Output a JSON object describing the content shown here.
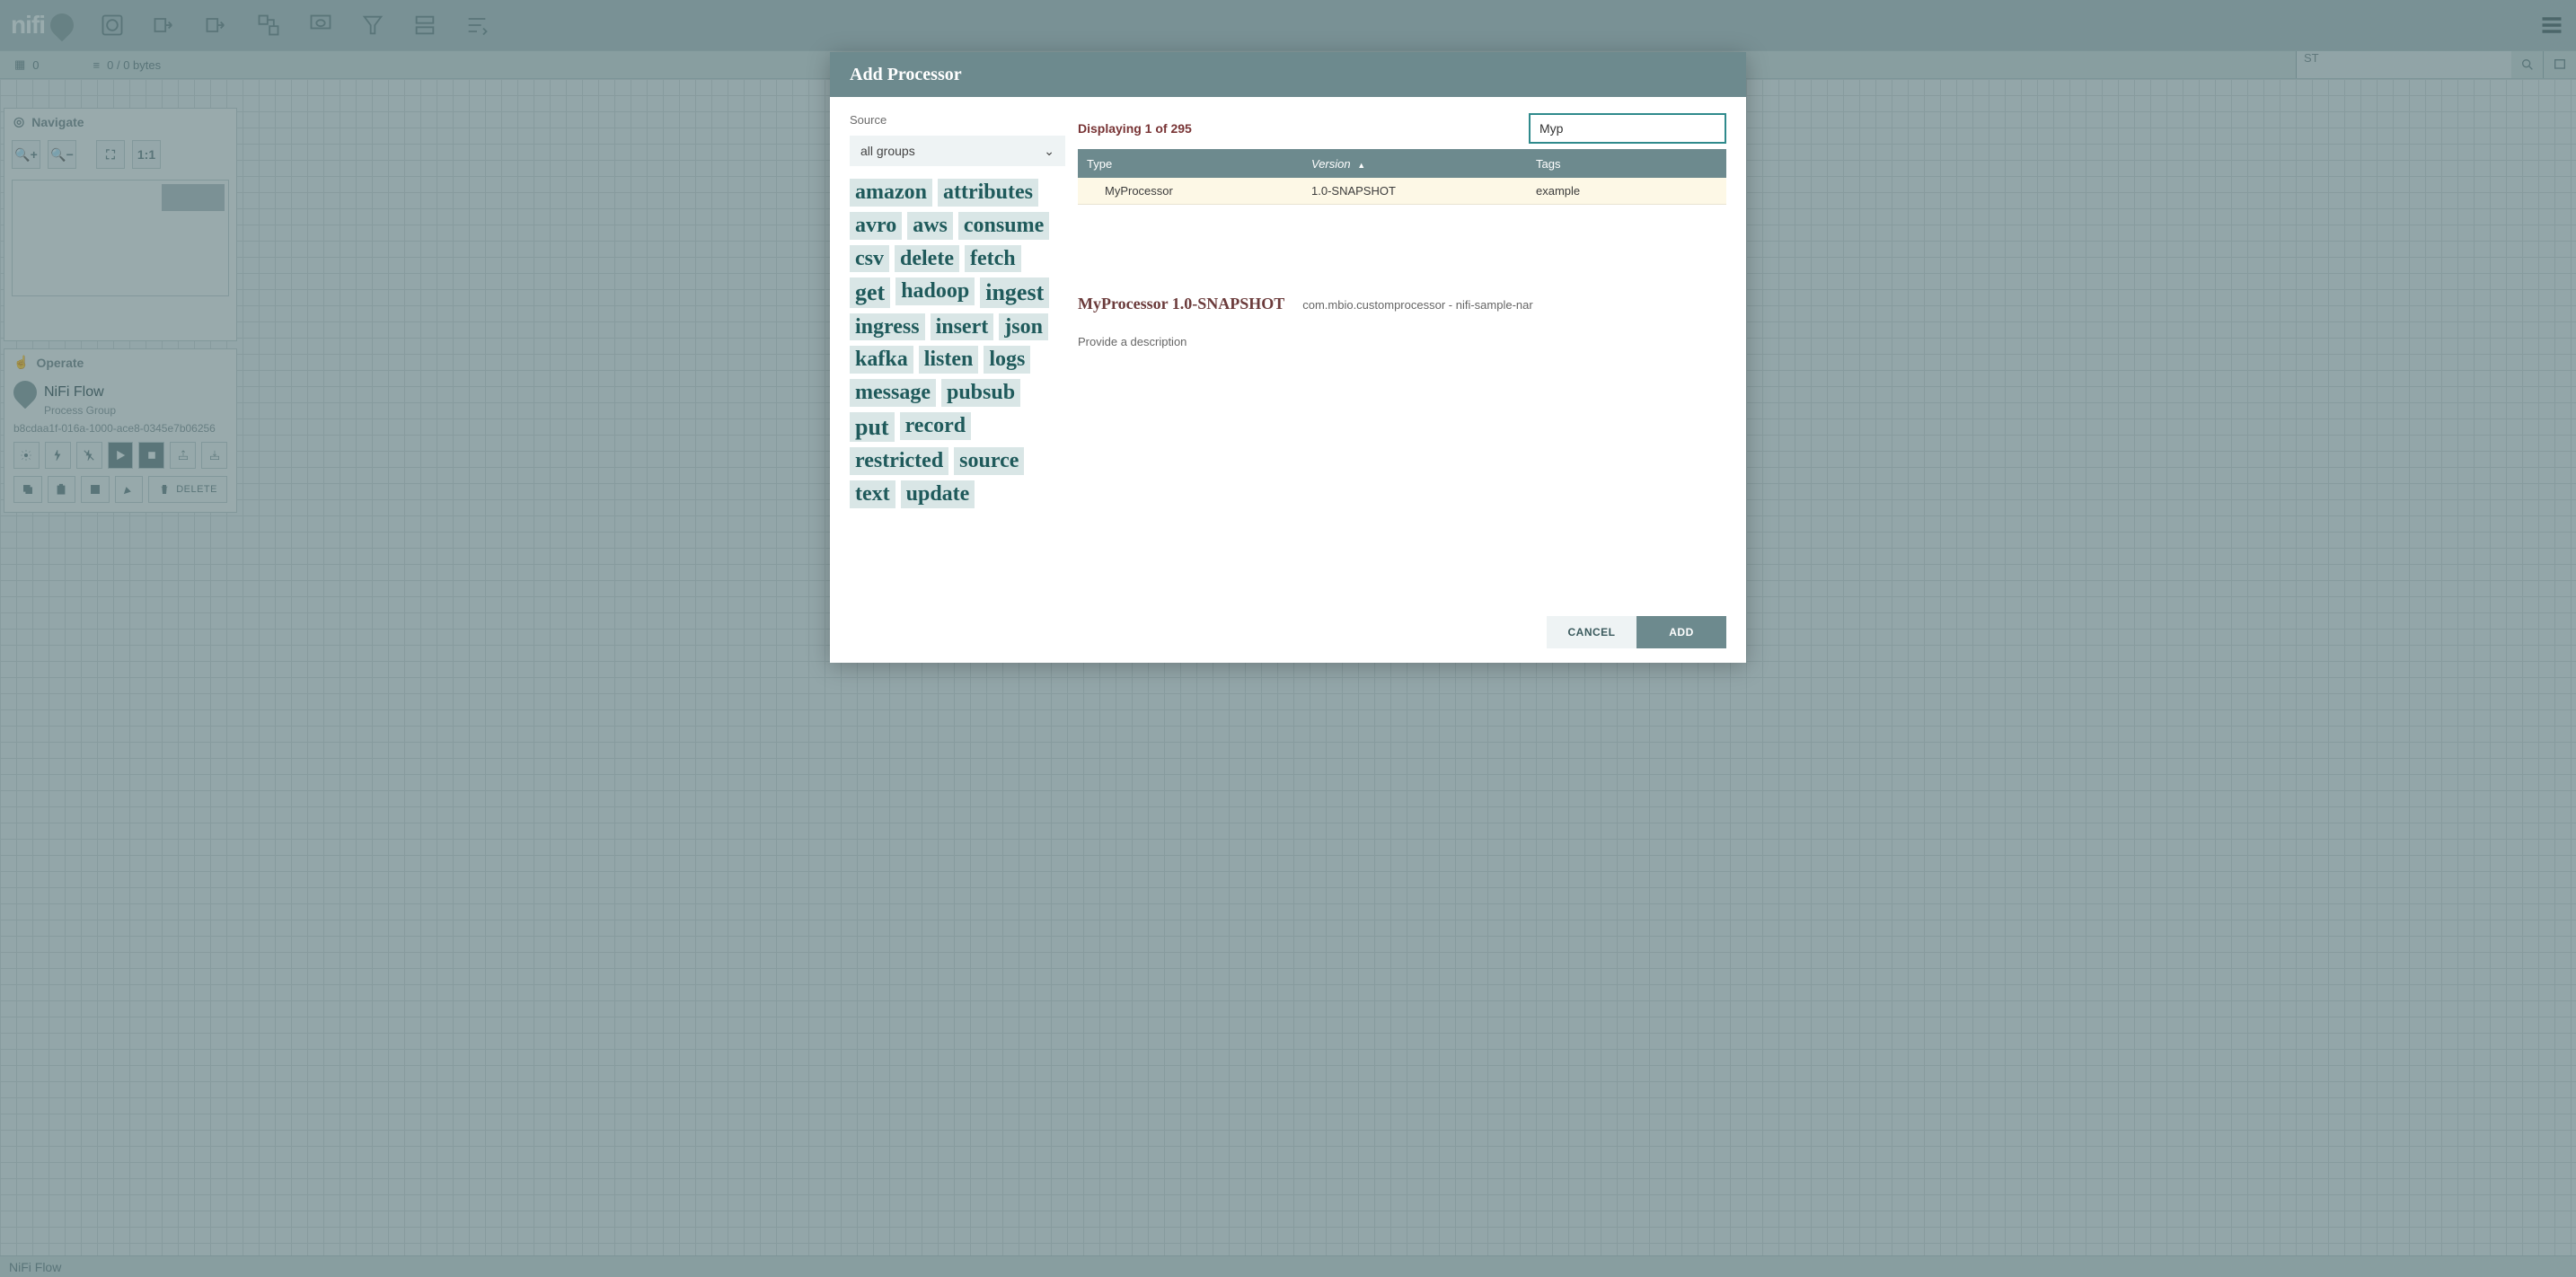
{
  "app_name": "nifi",
  "status_bar": {
    "groups": "0",
    "queue": "0 / 0 bytes",
    "jump_placeholder": "ST"
  },
  "navigate": {
    "title": "Navigate"
  },
  "operate": {
    "title": "Operate",
    "flow_name": "NiFi Flow",
    "flow_type": "Process Group",
    "flow_id": "b8cdaa1f-016a-1000-ace8-0345e7b06256",
    "delete_label": "DELETE"
  },
  "footer": {
    "breadcrumb": "NiFi Flow"
  },
  "dialog": {
    "title": "Add Processor",
    "source_label": "Source",
    "source_selected": "all groups",
    "display_text": "Displaying 1 of 295",
    "filter_value": "Myp",
    "table_headers": {
      "type": "Type",
      "version": "Version",
      "tags": "Tags"
    },
    "rows": [
      {
        "type": "MyProcessor",
        "version": "1.0-SNAPSHOT",
        "tags": "example"
      }
    ],
    "details": {
      "name": "MyProcessor 1.0-SNAPSHOT",
      "nar": "com.mbio.customprocessor - nifi-sample-nar",
      "description": "Provide a description"
    },
    "buttons": {
      "cancel": "CANCEL",
      "add": "ADD"
    },
    "tags": [
      {
        "t": "amazon",
        "s": 3
      },
      {
        "t": "attributes",
        "s": 3
      },
      {
        "t": "avro",
        "s": 3
      },
      {
        "t": "aws",
        "s": 3
      },
      {
        "t": "consume",
        "s": 3
      },
      {
        "t": "csv",
        "s": 3
      },
      {
        "t": "delete",
        "s": 3
      },
      {
        "t": "fetch",
        "s": 3
      },
      {
        "t": "get",
        "s": 4
      },
      {
        "t": "hadoop",
        "s": 3
      },
      {
        "t": "ingest",
        "s": 4
      },
      {
        "t": "ingress",
        "s": 3
      },
      {
        "t": "insert",
        "s": 3
      },
      {
        "t": "json",
        "s": 3
      },
      {
        "t": "kafka",
        "s": 3
      },
      {
        "t": "listen",
        "s": 3
      },
      {
        "t": "logs",
        "s": 3
      },
      {
        "t": "message",
        "s": 3
      },
      {
        "t": "pubsub",
        "s": 3
      },
      {
        "t": "put",
        "s": 4
      },
      {
        "t": "record",
        "s": 3
      },
      {
        "t": "restricted",
        "s": 3
      },
      {
        "t": "source",
        "s": 3
      },
      {
        "t": "text",
        "s": 3
      },
      {
        "t": "update",
        "s": 3
      }
    ]
  }
}
